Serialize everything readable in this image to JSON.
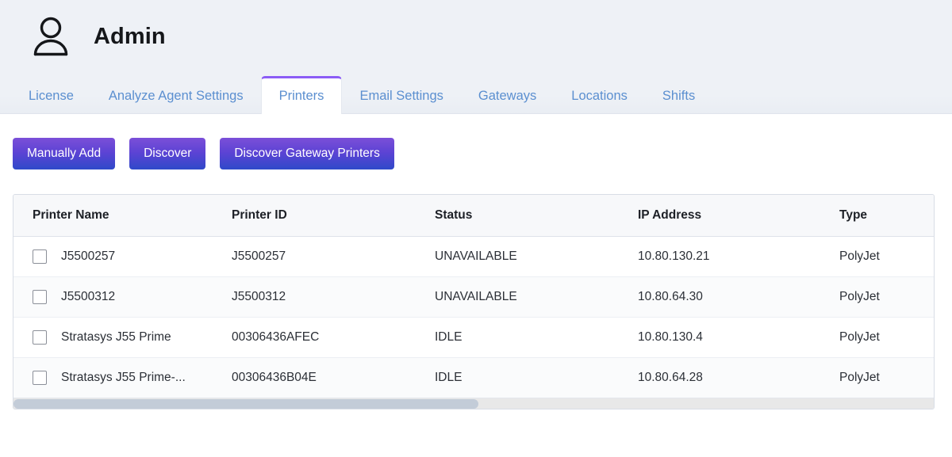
{
  "header": {
    "icon": "person-icon",
    "title": "Admin"
  },
  "tabs": [
    {
      "label": "License",
      "active": false
    },
    {
      "label": "Analyze Agent Settings",
      "active": false
    },
    {
      "label": "Printers",
      "active": true
    },
    {
      "label": "Email Settings",
      "active": false
    },
    {
      "label": "Gateways",
      "active": false
    },
    {
      "label": "Locations",
      "active": false
    },
    {
      "label": "Shifts",
      "active": false
    }
  ],
  "toolbar": {
    "manually_add_label": "Manually Add",
    "discover_label": "Discover",
    "discover_gateway_label": "Discover Gateway Printers"
  },
  "table": {
    "columns": [
      "Printer Name",
      "Printer ID",
      "Status",
      "IP Address",
      "Type"
    ],
    "rows": [
      {
        "checked": false,
        "printer_name": "J5500257",
        "printer_id": "J5500257",
        "status": "UNAVAILABLE",
        "ip_address": "10.80.130.21",
        "type": "PolyJet"
      },
      {
        "checked": false,
        "printer_name": "J5500312",
        "printer_id": "J5500312",
        "status": "UNAVAILABLE",
        "ip_address": "10.80.64.30",
        "type": "PolyJet"
      },
      {
        "checked": false,
        "printer_name": "Stratasys J55 Prime",
        "printer_id": "00306436AFEC",
        "status": "IDLE",
        "ip_address": "10.80.130.4",
        "type": "PolyJet"
      },
      {
        "checked": false,
        "printer_name": "Stratasys J55 Prime-...",
        "printer_id": "00306436B04E",
        "status": "IDLE",
        "ip_address": "10.80.64.28",
        "type": "PolyJet"
      }
    ]
  },
  "scrollbar": {
    "orientation": "horizontal",
    "thumb_width_percent": "50.5%"
  },
  "colors": {
    "page_background": "#eef1f6",
    "content_background": "#ffffff",
    "tab_text": "#5b8fd0",
    "active_tab_indicator": "#8b5cf6",
    "button_gradient_start": "#7b4fd8",
    "button_gradient_end": "#2f49c9",
    "table_header_background": "#f7f8fa",
    "table_border": "#d8dde6",
    "scrollbar_thumb": "#c3ccd8"
  }
}
